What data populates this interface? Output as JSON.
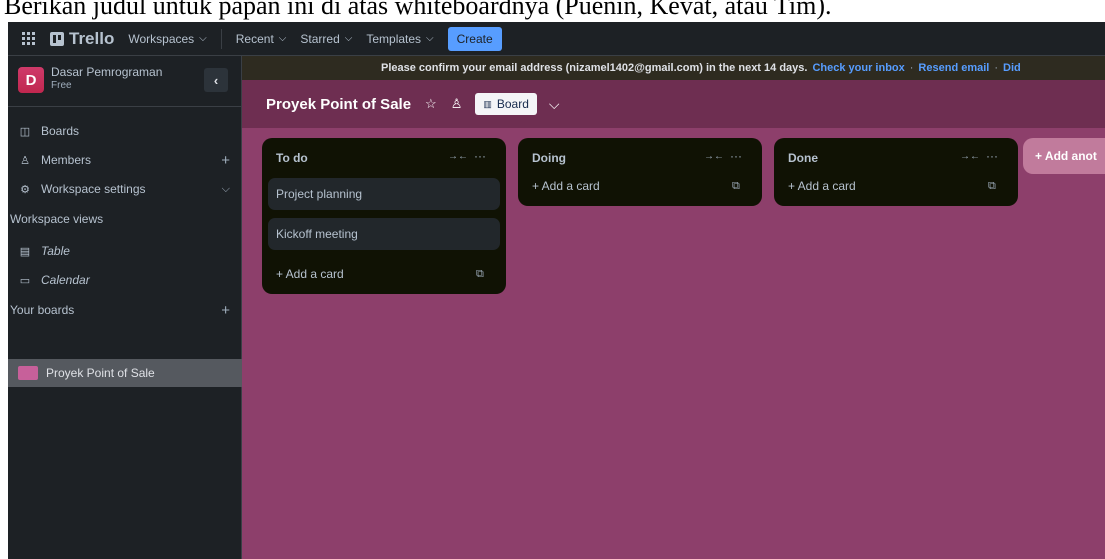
{
  "caption": "Berikan judul untuk papan ini di atas whiteboardnya (Puenin, Kevat, atau Tim).",
  "nav": {
    "logo": "Trello",
    "items": [
      "Workspaces",
      "Recent",
      "Starred",
      "Templates"
    ],
    "create": "Create"
  },
  "workspace": {
    "initial": "D",
    "name": "Dasar Pemrograman",
    "plan": "Free",
    "collapse_icon": "‹"
  },
  "sidebar": {
    "boards": "Boards",
    "members": "Members",
    "settings": "Workspace settings",
    "views_heading": "Workspace views",
    "table": "Table",
    "calendar": "Calendar",
    "your_boards": "Your boards",
    "active_board": "Proyek Point of Sale"
  },
  "banner": {
    "message": "Please confirm your email address (nizamel1402@gmail.com) in the next 14 days.",
    "check_inbox": "Check your inbox",
    "resend": "Resend email",
    "trailing": "Did"
  },
  "board": {
    "title": "Proyek Point of Sale",
    "view": "Board"
  },
  "lists": [
    {
      "title": "To do",
      "cards": [
        "Project planning",
        "Kickoff meeting"
      ],
      "add": "+ Add a card"
    },
    {
      "title": "Doing",
      "cards": [],
      "add": "+ Add a card"
    },
    {
      "title": "Done",
      "cards": [],
      "add": "+ Add a card"
    }
  ],
  "add_list": "+ Add anot",
  "colors": {
    "board_bg": "#8d3f6b",
    "header_bg": "#6e2e51",
    "list_bg": "#101204",
    "card_bg": "#22272b",
    "accent": "#579dff"
  }
}
